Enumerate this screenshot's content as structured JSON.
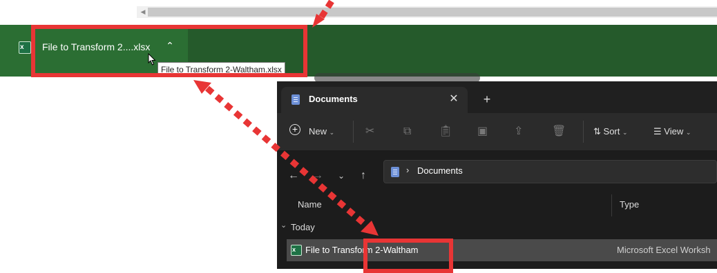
{
  "downloads_bar": {
    "item_name": "File to Transform 2....xlsx",
    "tooltip": "File to Transform 2-Waltham.xlsx",
    "chevron_icon": "chevron-up-icon",
    "file_icon": "excel-icon"
  },
  "explorer": {
    "tab_title": "Documents",
    "tab_close_glyph": "✕",
    "new_tab_glyph": "+",
    "toolbar": {
      "new_label": "New",
      "sort_label": "Sort",
      "view_label": "View"
    },
    "breadcrumb": {
      "current": "Documents"
    },
    "columns": {
      "name": "Name",
      "type": "Type"
    },
    "group_label": "Today",
    "files": [
      {
        "name": "File to Transform 2-Waltham",
        "type": "Microsoft Excel Worksh"
      }
    ]
  },
  "colors": {
    "download_bar": "#255a2b",
    "annotation_red": "#e83535",
    "explorer_bg": "#1c1c1c",
    "selected_row": "#4a4a4a"
  }
}
